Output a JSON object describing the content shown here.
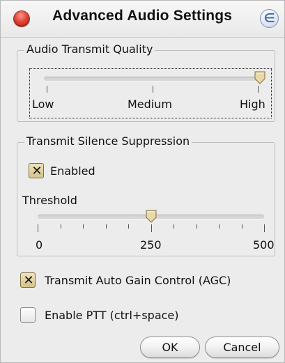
{
  "window": {
    "title": "Advanced Audio Settings",
    "help_icon_glyph": "∈"
  },
  "quality": {
    "legend": "Audio Transmit Quality",
    "labels": {
      "low": "Low",
      "medium": "Medium",
      "high": "High"
    },
    "level": 1.0
  },
  "suppression": {
    "legend": "Transmit Silence Suppression",
    "enabled_label": "Enabled",
    "enabled": true,
    "threshold_label": "Threshold",
    "threshold_value": 250,
    "tick_labels": {
      "min": "0",
      "mid": "250",
      "max": "500"
    }
  },
  "agc": {
    "label": "Transmit Auto Gain Control (AGC)",
    "checked": true
  },
  "ptt": {
    "label": "Enable PTT (ctrl+space)",
    "checked": false
  },
  "buttons": {
    "ok": "OK",
    "cancel": "Cancel"
  },
  "icons": {
    "close": "close-button-icon",
    "help": "help-icon",
    "check": "✕"
  }
}
